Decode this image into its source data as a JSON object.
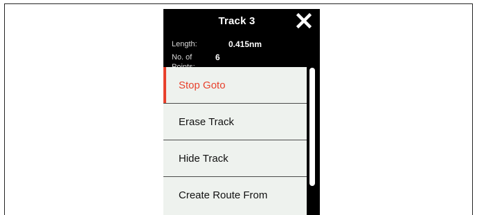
{
  "panel": {
    "title": "Track 3",
    "close_icon": "close-icon",
    "info": {
      "length_label": "Length:",
      "length_value": "0.415nm",
      "points_label": "No. of Points:",
      "points_value": "6"
    }
  },
  "menu": {
    "items": [
      {
        "label": "Stop Goto",
        "active": true
      },
      {
        "label": "Erase Track",
        "active": false
      },
      {
        "label": "Hide Track",
        "active": false
      },
      {
        "label": "Create Route From",
        "active": false
      }
    ]
  },
  "colors": {
    "accent": "#e8412c",
    "header_bg": "#000000",
    "menu_bg": "#eef2ee"
  }
}
